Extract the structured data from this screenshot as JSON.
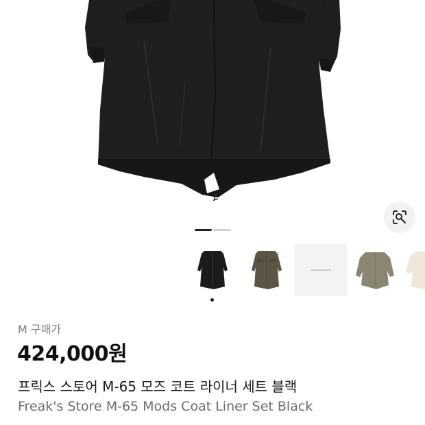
{
  "product": {
    "size_label": "M 구매가",
    "price": "424,000원",
    "name_ko": "프릭스 스토어 M-65 모즈 코트 라이너 세트 블랙",
    "name_en": "Freak's Store M-65 Mods Coat Liner Set Black"
  },
  "gallery": {
    "current_slide": 1,
    "slide_count": 2,
    "lens_icon": "lens-search-icon",
    "thumbnails": [
      {
        "name": "thumbnail-black-coat",
        "color": "#1c1c1c",
        "selected": true
      },
      {
        "name": "thumbnail-olive-coat",
        "color": "#5b5546",
        "selected": false
      },
      {
        "name": "thumbnail-brand-placeholder",
        "color": "#f3f3f3",
        "selected": false
      },
      {
        "name": "thumbnail-khaki-coat",
        "color": "#8b8674",
        "selected": false
      },
      {
        "name": "thumbnail-cream-coat",
        "color": "#efe8da",
        "selected": false
      }
    ]
  },
  "colors": {
    "coat": "#1c1c1c",
    "price": "#111111",
    "muted_text": "#7d7d7d"
  }
}
